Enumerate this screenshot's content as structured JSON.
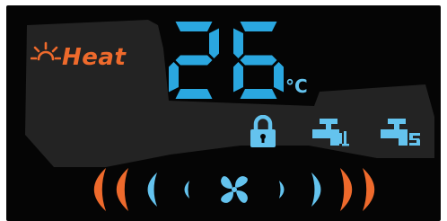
{
  "display": {
    "mode_label": "Heat",
    "mode_icon": "sun-icon",
    "temperature_value": "26",
    "temperature_unit": "°C",
    "status_icons": [
      "lock-icon",
      "water-valve-1-icon",
      "water-valve-2-icon"
    ],
    "fan_speed_icon": "fan-icon",
    "colors": {
      "background": "#050505",
      "shape": "#232323",
      "mode": "#ee6a2c",
      "digits": "#2aa7e0",
      "icons": "#64c3ee",
      "speed_bars_low": "#64c3ee",
      "speed_bars_high": "#ee6a2c"
    }
  }
}
